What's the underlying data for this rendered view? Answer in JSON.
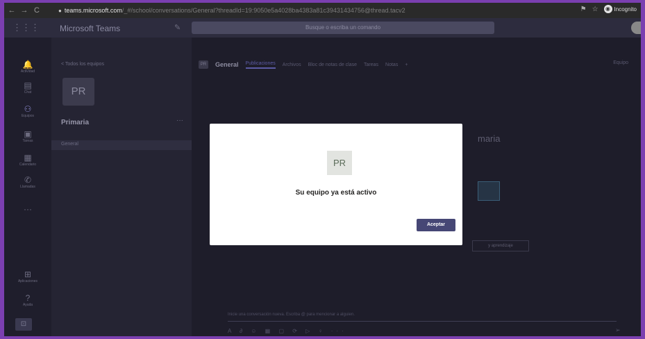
{
  "browser": {
    "back": "←",
    "forward": "→",
    "reload": "C",
    "lock": "●",
    "url_host": "teams.microsoft.com",
    "url_rest": "/_#/school/conversations/General?threadId=19:9050e5a4028ba4383a81c39431434756@thread.tacv2&ctx=channel",
    "incognito_label": "Incognito"
  },
  "teams": {
    "waffle": "⋮⋮⋮",
    "app_title": "Microsoft Teams",
    "edit_icon": "✎",
    "search_placeholder": "Busque o escriba un comando"
  },
  "rail": {
    "items": [
      {
        "icon": "🔔",
        "label": "Actividad"
      },
      {
        "icon": "▤",
        "label": "Chat"
      },
      {
        "icon": "⚇",
        "label": "Equipos"
      },
      {
        "icon": "▣",
        "label": "Tareas"
      },
      {
        "icon": "▦",
        "label": "Calendario"
      },
      {
        "icon": "✆",
        "label": "Llamadas"
      },
      {
        "icon": "···",
        "label": ""
      }
    ],
    "apps": {
      "icon": "⊞",
      "label": "Aplicaciones"
    },
    "help": {
      "icon": "?",
      "label": "Ayuda"
    },
    "bottom_icon": "⊡"
  },
  "team_panel": {
    "back_link": "< Todos los equipos",
    "avatar_initials": "PR",
    "team_name": "Primaria",
    "more": "···",
    "channel": "General"
  },
  "main": {
    "channel_badge": "PR",
    "channel_title": "General",
    "tabs": [
      "Publicaciones",
      "Archivos",
      "Bloc de notas de clase",
      "Tareas",
      "Notas",
      "+"
    ],
    "team_button": "Equipo",
    "background_title": "maria",
    "background_button": "y aprendizaje",
    "compose_placeholder": "Inicie una conversación nueva. Escriba @ para mencionar a alguien.",
    "compose_tools": "A ∂ ☺ ▦ ▢ ⟳ ▷ ♀ ···",
    "send_icon": "➢"
  },
  "modal": {
    "avatar_initials": "PR",
    "message": "Su equipo ya está activo",
    "accept_label": "Aceptar"
  }
}
